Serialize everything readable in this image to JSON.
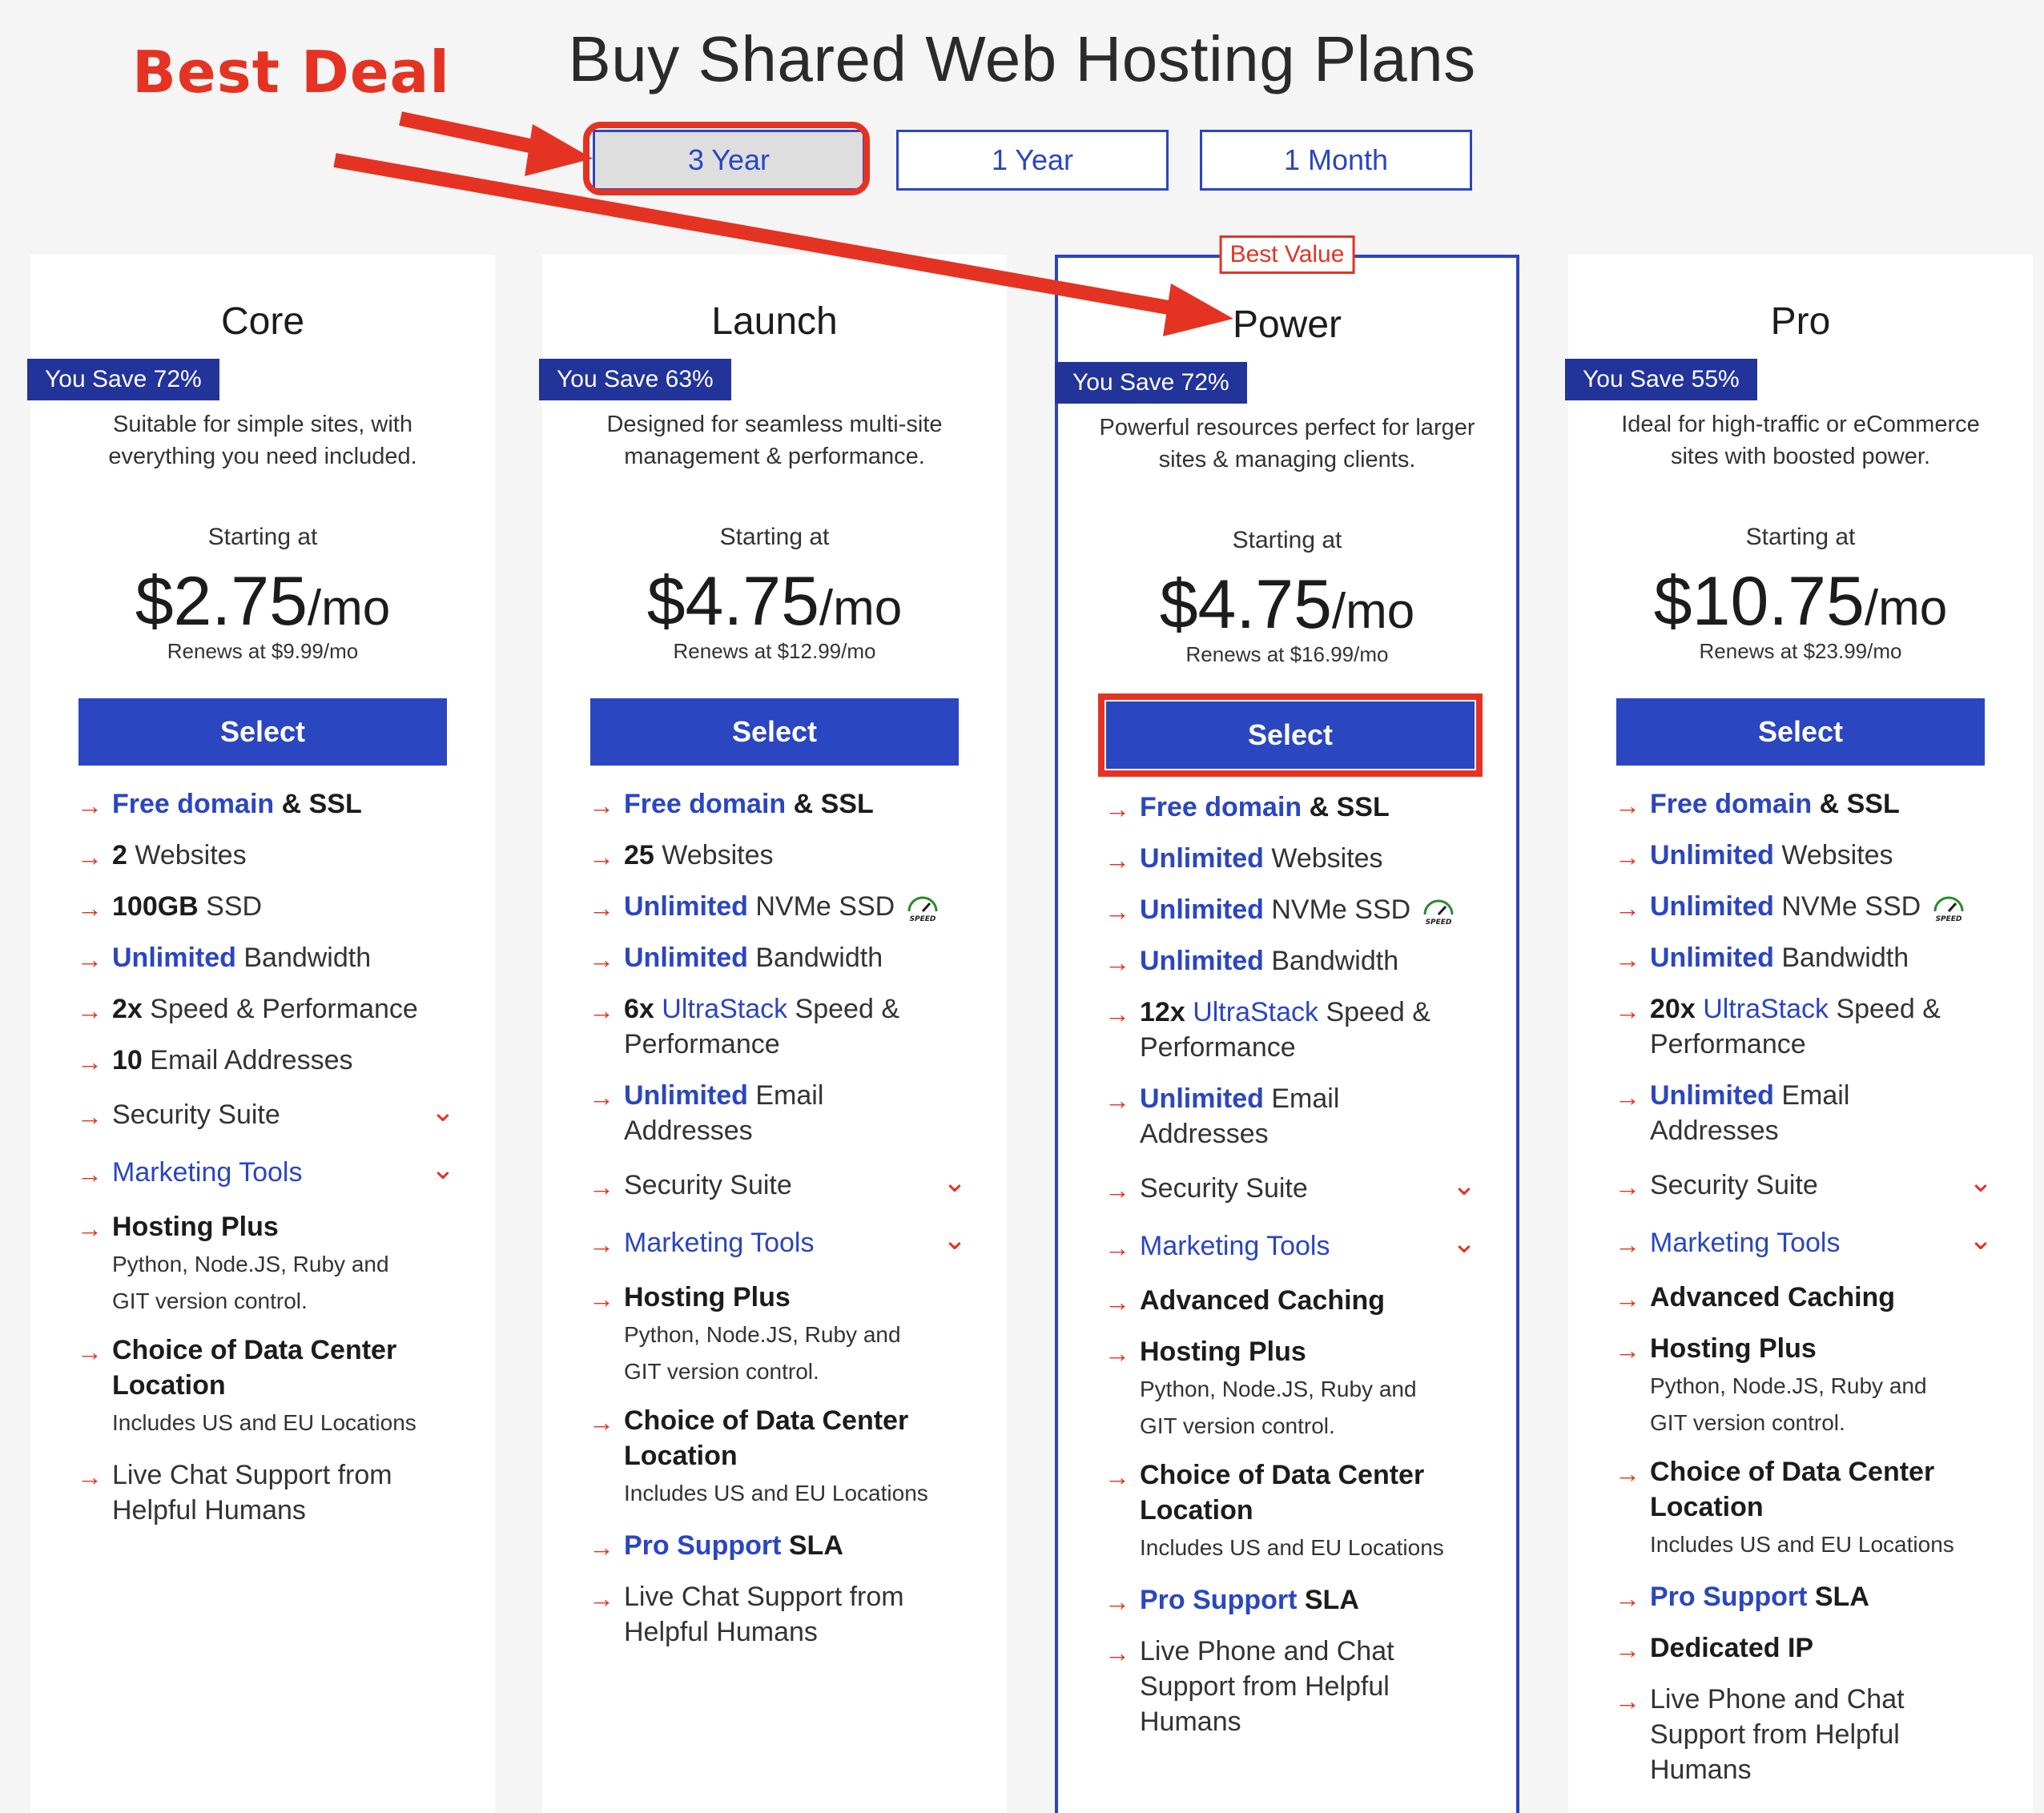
{
  "page": {
    "title": "Buy Shared Web Hosting Plans",
    "annotation": "Best Deal"
  },
  "terms": [
    {
      "label": "3 Year",
      "active": true
    },
    {
      "label": "1 Year",
      "active": false
    },
    {
      "label": "1 Month",
      "active": false
    }
  ],
  "common": {
    "starting_at": "Starting at",
    "per_month": "/mo",
    "select_label": "Select",
    "best_value": "Best Value",
    "free_domain": "Free domain",
    "amp_ssl": " & SSL",
    "websites": " Websites",
    "ssd": " SSD",
    "nvme_ssd": " NVMe SSD",
    "bandwidth": " Bandwidth",
    "unlimited": "Unlimited",
    "speed_perf": " Speed & Performance",
    "ultrastack": "UltraStack",
    "speed_amp": " Speed &",
    "performance": "Performance",
    "email_addresses": " Email Addresses",
    "email": " Email",
    "addresses": "Addresses",
    "security_suite": "Security Suite",
    "marketing_tools": "Marketing Tools",
    "hosting_plus": "Hosting Plus",
    "hosting_plus_sub1": "Python,   Node.JS,   Ruby and",
    "hosting_plus_sub2": "GIT version control.",
    "data_center": "Choice of Data Center Location",
    "data_center_sub": "Includes US and EU Locations",
    "live_chat": "Live Chat Support from Helpful Humans",
    "pro_support": "Pro Support",
    "sla": " SLA",
    "advanced_caching": "Advanced Caching",
    "live_phone": "Live Phone and Chat Support from Helpful Humans",
    "dedicated_ip": "Dedicated IP",
    "speed_icon": "speed-gauge-icon",
    "arrow_icon": "arrow-right-icon",
    "chevron_icon": "chevron-down-icon"
  },
  "plans": [
    {
      "name": "Core",
      "save": "You Save 72%",
      "desc": "Suitable for simple sites, with everything you need included.",
      "price": "$2.75",
      "renews": "Renews at $9.99/mo",
      "websites_count": "2",
      "storage": "100GB",
      "speed_mult": "2x",
      "email_count": "10"
    },
    {
      "name": "Launch",
      "save": "You Save 63%",
      "desc": "Designed for seamless multi-site management & performance.",
      "price": "$4.75",
      "renews": "Renews at $12.99/mo",
      "websites_count": "25",
      "speed_mult": "6x"
    },
    {
      "name": "Power",
      "save": "You Save 72%",
      "desc": "Powerful resources perfect for larger sites & managing clients.",
      "price": "$4.75",
      "renews": "Renews at $16.99/mo",
      "speed_mult": "12x"
    },
    {
      "name": "Pro",
      "save": "You Save 55%",
      "desc": "Ideal for high-traffic or eCommerce sites with boosted power.",
      "price": "$10.75",
      "renews": "Renews at $23.99/mo",
      "speed_mult": "20x"
    }
  ],
  "colors": {
    "accent": "#2a46c0",
    "badge": "#22339a",
    "annotation": "#e53323",
    "background": "#f5f5f5"
  }
}
